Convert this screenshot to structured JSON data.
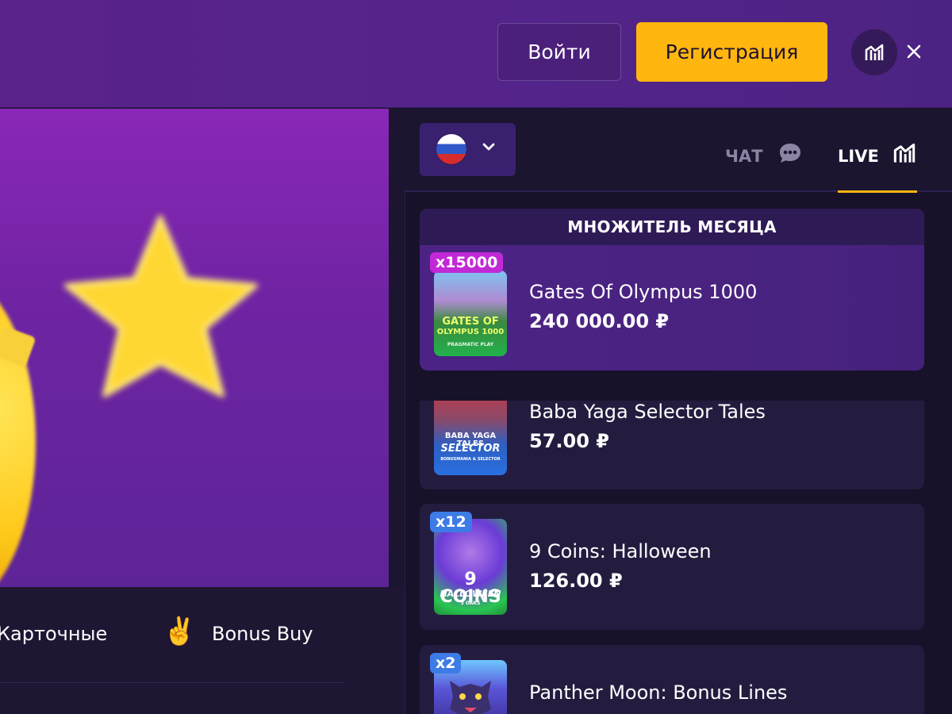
{
  "header": {
    "login_label": "Войти",
    "register_label": "Регистрация",
    "stats_icon": "stats-icon",
    "close_icon": "close-icon"
  },
  "categories": [
    {
      "label": "Карточные"
    },
    {
      "label": "Bonus Buy",
      "icon": "✌️"
    }
  ],
  "panel": {
    "language_flag": "russia-flag",
    "tabs": [
      {
        "label": "ЧАТ",
        "icon": "chat-icon",
        "active": false
      },
      {
        "label": "LIVE",
        "icon": "stats-icon",
        "active": true
      }
    ]
  },
  "feed": {
    "featured_title": "МНОЖИТЕЛЬ МЕСЯЦА",
    "items": [
      {
        "badge": "x15000",
        "name": "Gates Of Olympus 1000",
        "amount": "240 000.00 ₽",
        "thumb_lines": [
          "GATES OF",
          "OLYMPUS 1000"
        ],
        "thumb_sub": "PRAGMATIC PLAY"
      },
      {
        "badge": "",
        "name": "Baba Yaga Selector Tales",
        "amount": "57.00 ₽",
        "thumb_lines": [
          "BABA YAGA TALES",
          "SELECTOR"
        ],
        "thumb_sub": "BONUSMANIA & SELECTOR"
      },
      {
        "badge": "x12",
        "name": "9 Coins: Halloween",
        "amount": "126.00 ₽",
        "thumb_lines": [
          "9 COINS",
          "HALLOWEEN"
        ],
        "thumb_sub": "3 OAKS"
      },
      {
        "badge": "x2",
        "name": "Panther Moon: Bonus Lines",
        "amount": "",
        "thumb_lines": [],
        "thumb_sub": ""
      }
    ]
  },
  "colors": {
    "accent": "#ffb60e",
    "badge_featured": "#c229d6",
    "badge_regular": "#3d7be6"
  }
}
